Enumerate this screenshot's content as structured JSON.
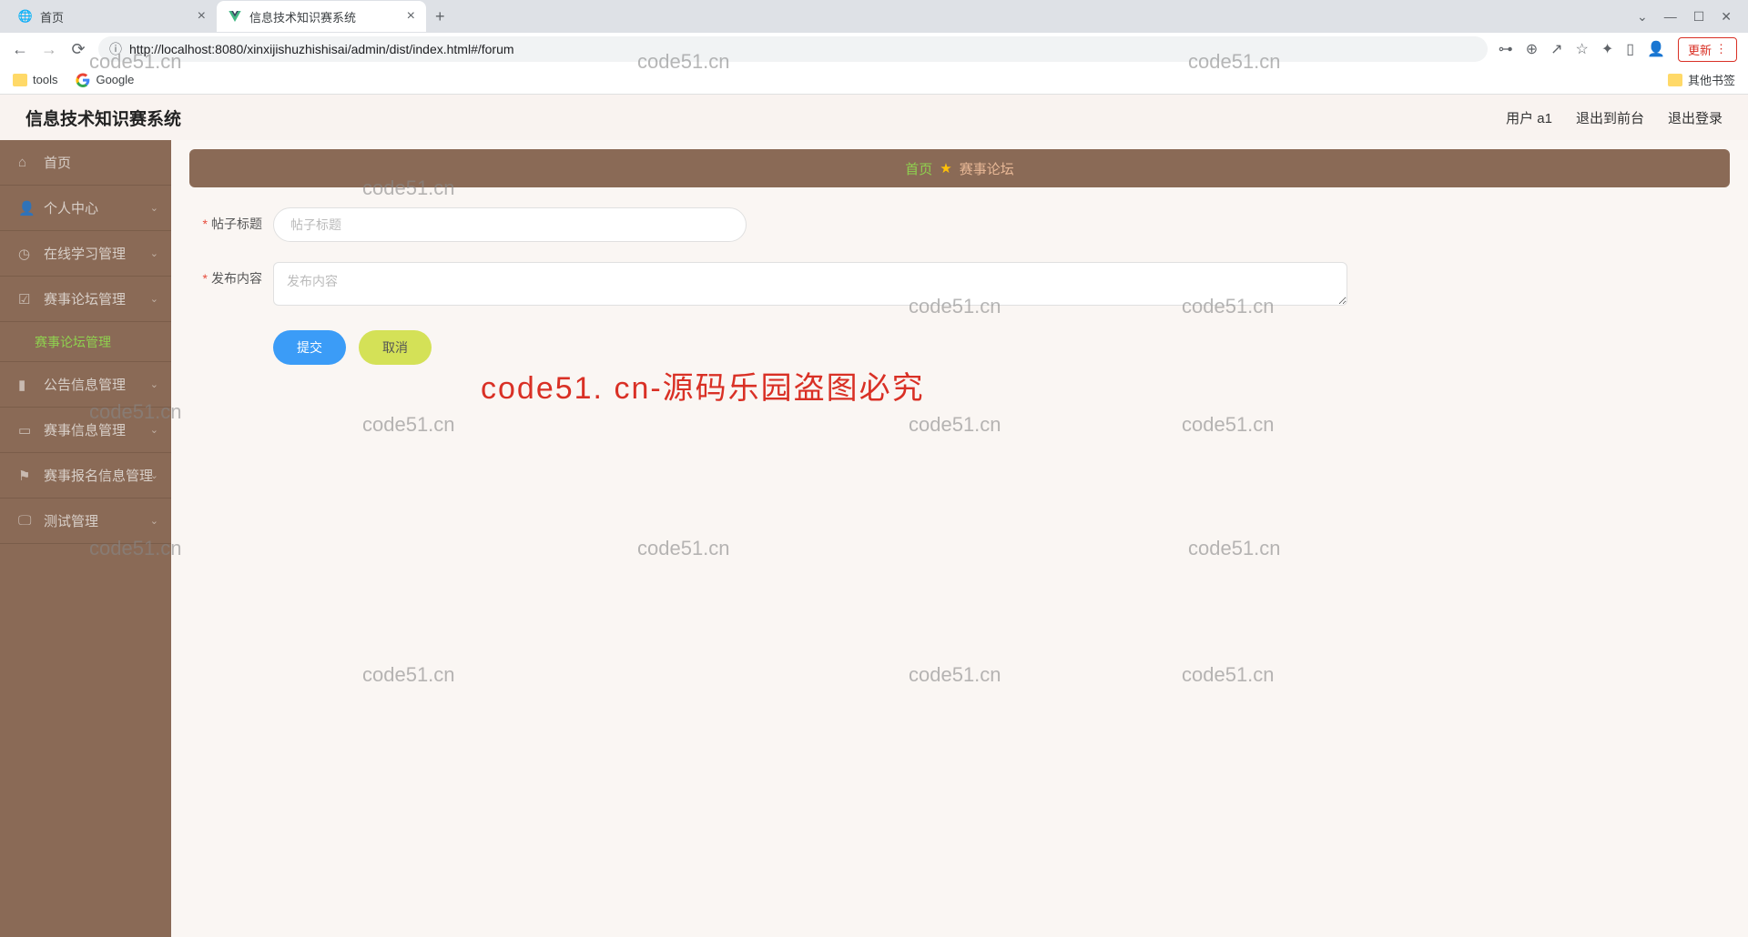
{
  "browser": {
    "tabs": [
      {
        "title": "首页",
        "active": false
      },
      {
        "title": "信息技术知识赛系统",
        "active": true
      }
    ],
    "url": "http://localhost:8080/xinxijishuzhishisai/admin/dist/index.html#/forum",
    "update_label": "更新",
    "bookmarks": {
      "tools": "tools",
      "google": "Google",
      "other": "其他书签"
    }
  },
  "header": {
    "title": "信息技术知识赛系统",
    "user": "用户 a1",
    "to_front": "退出到前台",
    "logout": "退出登录"
  },
  "sidebar": {
    "items": [
      {
        "label": "首页",
        "icon": "home"
      },
      {
        "label": "个人中心",
        "icon": "user"
      },
      {
        "label": "在线学习管理",
        "icon": "clock"
      },
      {
        "label": "赛事论坛管理",
        "icon": "check",
        "expanded": true,
        "children": [
          {
            "label": "赛事论坛管理"
          }
        ]
      },
      {
        "label": "公告信息管理",
        "icon": "pin"
      },
      {
        "label": "赛事信息管理",
        "icon": "card"
      },
      {
        "label": "赛事报名信息管理",
        "icon": "flag"
      },
      {
        "label": "测试管理",
        "icon": "monitor"
      }
    ]
  },
  "breadcrumb": {
    "home": "首页",
    "current": "赛事论坛"
  },
  "form": {
    "title_label": "帖子标题",
    "title_placeholder": "帖子标题",
    "content_label": "发布内容",
    "content_placeholder": "发布内容",
    "submit": "提交",
    "cancel": "取消"
  },
  "watermark": {
    "text": "code51.cn",
    "big": "code51. cn-源码乐园盗图必究"
  }
}
